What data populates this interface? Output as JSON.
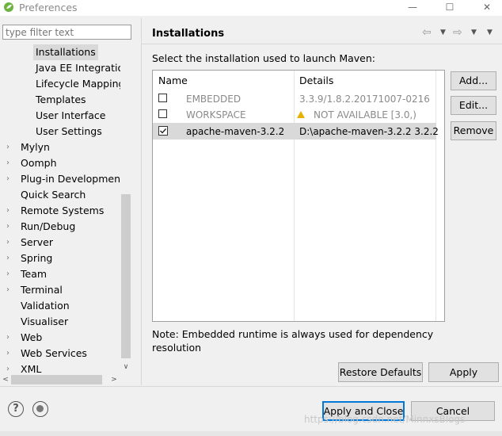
{
  "window": {
    "title": "Preferences",
    "minimize": "—",
    "maximize": "☐",
    "close": "✕"
  },
  "filter": {
    "placeholder": "type filter text"
  },
  "tree": {
    "maven_children": [
      "Installations",
      "Java EE Integratio",
      "Lifecycle Mapping",
      "Templates",
      "User Interface",
      "User Settings"
    ],
    "top_items": [
      "Mylyn",
      "Oomph",
      "Plug-in Development",
      "Quick Search",
      "Remote Systems",
      "Run/Debug",
      "Server",
      "Spring",
      "Team",
      "Terminal",
      "Validation",
      "Visualiser",
      "Web",
      "Web Services",
      "XML"
    ],
    "selected": "Installations"
  },
  "page": {
    "title": "Installations",
    "description": "Select the installation used to launch Maven:",
    "columns": [
      "Name",
      "Details"
    ],
    "rows": [
      {
        "name": "EMBEDDED",
        "details": "3.3.9/1.8.2.20171007-0216",
        "checked": false,
        "disabled": true
      },
      {
        "name": "WORKSPACE",
        "details": "NOT AVAILABLE [3.0,)",
        "checked": false,
        "disabled": true,
        "warning": true
      },
      {
        "name": "apache-maven-3.2.2",
        "details": "D:\\apache-maven-3.2.2 3.2.2",
        "checked": true,
        "disabled": false
      }
    ],
    "buttons": {
      "add": "Add...",
      "edit": "Edit...",
      "remove": "Remove"
    },
    "note": "Note: Embedded runtime is always used for dependency resolution",
    "restore_defaults": "Restore Defaults",
    "apply": "Apply"
  },
  "footer": {
    "help": "?",
    "apply_close": "Apply and Close",
    "cancel": "Cancel",
    "watermark": "https://blog.csdn.net/MinnxsBlogs"
  },
  "colors": {
    "selection": "#d9d9d9",
    "accent": "#0078d7",
    "warning": "#e8b000"
  }
}
